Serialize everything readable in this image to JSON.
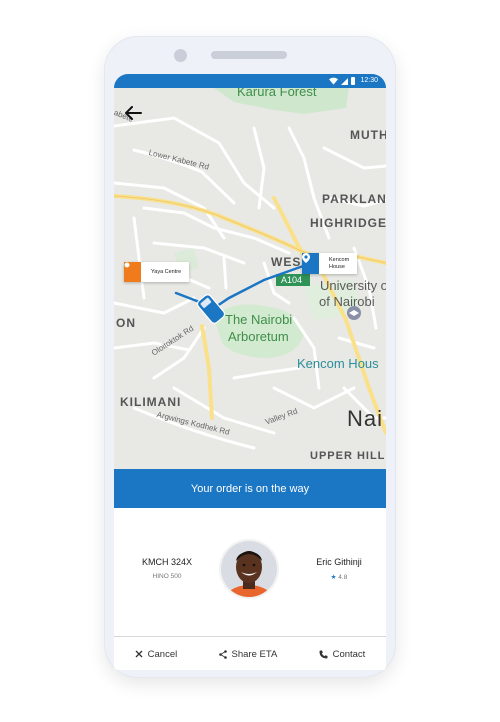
{
  "status_bar": {
    "time": "12:30",
    "icons": [
      "wifi-icon",
      "signal-icon",
      "battery-icon"
    ]
  },
  "map": {
    "labels": {
      "karura_forest": "Karura Forest",
      "muth": "MUTH",
      "parklan": "PARKLAN",
      "highridge": "HIGHRIDGE",
      "wes": "WES",
      "a104": "A104",
      "university_line1": "University of",
      "university_line2": "of Nairobi",
      "arboretum_line1": "The Nairobi",
      "arboretum_line2": "Arboretum",
      "kencom_house": "Kencom Hous",
      "kilimani": "KILIMANI",
      "nai": "Nai",
      "upper_hill": "UPPER HILL",
      "lower_kabete": "Lower Kabete Rd",
      "kabete": "abete",
      "oloitoktok": "Oloitoktok Rd",
      "argwings": "Argwings Kodhek Rd",
      "valley": "Valley Rd",
      "on": "ON"
    },
    "origin_pin": {
      "label": "Yaya Centre",
      "color": "#f07b1d"
    },
    "destination_pin": {
      "label_line1": "Kencom",
      "label_line2": "House",
      "color": "#1b76c4"
    }
  },
  "banner": {
    "text": "Your order is on the way"
  },
  "vehicle": {
    "plate": "KMCH 324X",
    "model": "HINO 500"
  },
  "driver": {
    "name": "Eric Githinji",
    "rating": "4.8"
  },
  "actions": {
    "cancel": "Cancel",
    "share": "Share ETA",
    "contact": "Contact"
  },
  "colors": {
    "primary": "#1b76c4",
    "accent": "#f07b1d",
    "park": "#c8e6c9",
    "road": "#fde293"
  }
}
